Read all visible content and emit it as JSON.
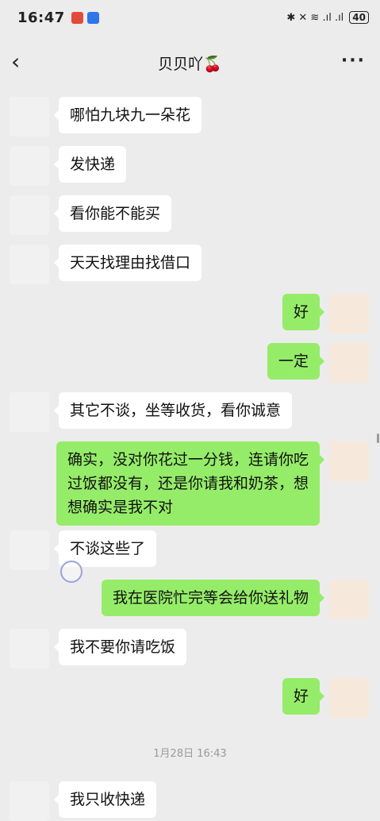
{
  "status_bar": {
    "time": "16:47",
    "icons": "✱ ✕ ≋ .ıl .ıl",
    "battery": "40"
  },
  "header": {
    "title": "贝贝吖🍒",
    "back_icon": "‹",
    "more_icon": "···"
  },
  "messages": [
    {
      "side": "left",
      "text": "哪怕九块九一朵花"
    },
    {
      "side": "left",
      "text": "发快递"
    },
    {
      "side": "left",
      "text": "看你能不能买"
    },
    {
      "side": "left",
      "text": "天天找理由找借口"
    },
    {
      "side": "right",
      "text": "好"
    },
    {
      "side": "right",
      "text": "一定"
    },
    {
      "side": "left",
      "text": "其它不谈，坐等收货，看你诚意"
    },
    {
      "side": "right",
      "text": "确实，没对你花过一分钱，连请你吃过饭都没有，还是你请我和奶茶，想想确实是我不对"
    },
    {
      "side": "left",
      "text": "不谈这些了"
    },
    {
      "side": "right",
      "text": "我在医院忙完等会给你送礼物"
    },
    {
      "side": "left",
      "text": "我不要你请吃饭"
    },
    {
      "side": "right",
      "text": "好"
    },
    {
      "side": "left",
      "text": "我只收快递"
    }
  ],
  "timestamp": "1月28日 16:43",
  "colors": {
    "background": "#ececec",
    "bubble_self": "#95ec69",
    "bubble_other": "#ffffff"
  }
}
